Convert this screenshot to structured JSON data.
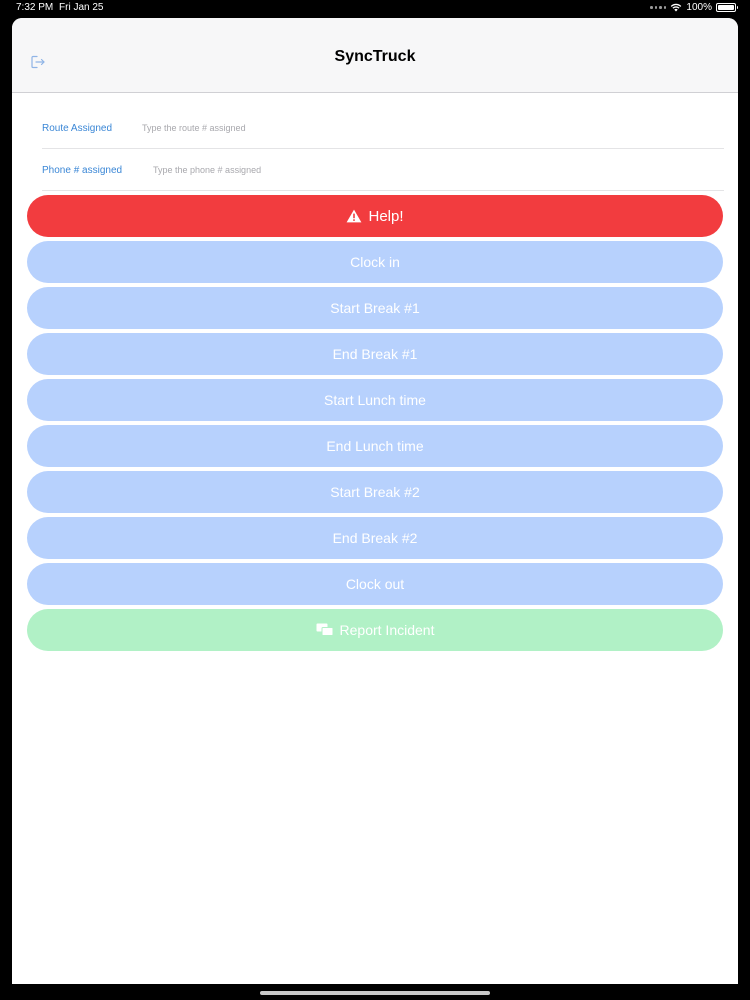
{
  "status_bar": {
    "time": "7:32 PM",
    "date": "Fri Jan 25",
    "battery": "100%",
    "battery_level": 1.0
  },
  "nav": {
    "title": "SyncTruck"
  },
  "form": {
    "route": {
      "label": "Route Assigned",
      "placeholder": "Type the route # assigned",
      "value": ""
    },
    "phone": {
      "label": "Phone # assigned",
      "placeholder": "Type the phone # assigned",
      "value": ""
    }
  },
  "buttons": {
    "help": "Help!",
    "clock_in": "Clock in",
    "start_break_1": "Start Break #1",
    "end_break_1": "End Break #1",
    "start_lunch": "Start Lunch time",
    "end_lunch": "End Lunch time",
    "start_break_2": "Start Break #2",
    "end_break_2": "End Break #2",
    "clock_out": "Clock out",
    "report_incident": "Report Incident"
  },
  "colors": {
    "help": "#f23c3f",
    "action": "#b7d1fd",
    "report": "#b1f1c6",
    "label": "#3b87d6"
  },
  "icons": {
    "logout": "logout-icon",
    "help": "warning-triangle-icon",
    "report": "chat-bubbles-icon"
  }
}
